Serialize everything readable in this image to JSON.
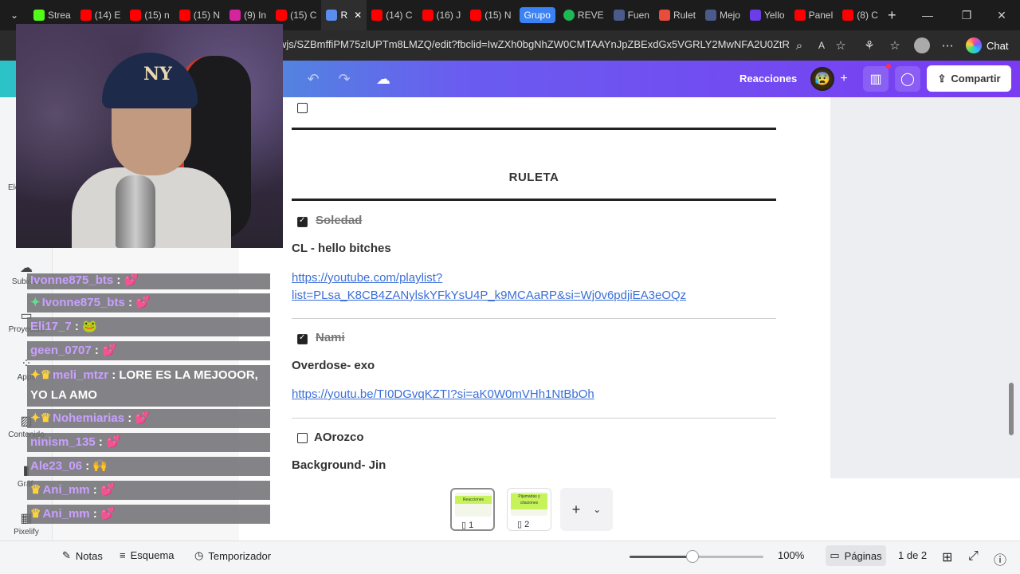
{
  "browser": {
    "tabs": [
      {
        "label": "Strea",
        "color": "#53fc18"
      },
      {
        "label": "(14) E",
        "color": "#ff0000"
      },
      {
        "label": "(15) n",
        "color": "#ff0000"
      },
      {
        "label": "(15) N",
        "color": "#ff0000"
      },
      {
        "label": "(9) In",
        "color": "#d6249f"
      },
      {
        "label": "(15) C",
        "color": "#ff0000"
      },
      {
        "label": "R",
        "color": "#5b8def"
      },
      {
        "label": "(14) C",
        "color": "#ff0000"
      },
      {
        "label": "(16) J",
        "color": "#ff0000"
      },
      {
        "label": "(15) N",
        "color": "#ff0000"
      }
    ],
    "group_label": "Grupo",
    "tabs_right": [
      {
        "label": "REVE",
        "color": "#1db954"
      },
      {
        "label": "Fuen",
        "color": "#4a5a8a"
      },
      {
        "label": "Rulet",
        "color": "#e84c3d"
      },
      {
        "label": "Mejo",
        "color": "#4a5a8a"
      },
      {
        "label": "Yello",
        "color": "#6a3de8"
      },
      {
        "label": "Panel",
        "color": "#ff0000"
      },
      {
        "label": "(8) C",
        "color": "#ff0000"
      }
    ],
    "url": "wjs/SZBmffiPM75zlUPTm8LMZQ/edit?fbclid=IwZXh0bgNhZW0CMTAAYnJpZBExdGx5VGRLY2MwNFA2U0ZtR...",
    "chat_label": "Chat"
  },
  "canva": {
    "reacciones": "Reacciones",
    "share_label": "Compartir",
    "sidebar": [
      "Subidos",
      "Proyectos",
      "Apps",
      "Contenido",
      "Gráf.",
      "Pixelify"
    ],
    "sidebar_partial": "Ele"
  },
  "doc": {
    "title": "RULETA",
    "entries": [
      {
        "name": "Soledad",
        "done": true,
        "song": "CL - hello bitches",
        "link_line1": "https://youtube.com/playlist?",
        "link_line2": "list=PLsa_K8CB4ZANylskYFkYsU4P_k9MCAaRP&si=Wj0v6pdjiEA3eOQz"
      },
      {
        "name": "Nami",
        "done": true,
        "song": "Overdose- exo",
        "link_line1": "https://youtu.be/TI0DGvqKZTI?si=aK0W0mVHh1NtBbOh",
        "link_line2": ""
      },
      {
        "name": "AOrozco",
        "done": false,
        "song": "Background- Jin",
        "link_line1": "",
        "link_line2": ""
      }
    ]
  },
  "pages": {
    "thumbs": [
      {
        "num": "1",
        "caption": "Reacciones"
      },
      {
        "num": "2",
        "caption": "Pijamadas y citaciones"
      }
    ]
  },
  "bottom": {
    "notas": "Notas",
    "esquema": "Esquema",
    "temporizador": "Temporizador",
    "zoom": "100%",
    "zoom_value": 0.47,
    "paginas": "Páginas",
    "page_count": "1 de 2"
  },
  "stream_chat": [
    {
      "user": "Ivonne875_bts",
      "sep": " : ",
      "msg": "",
      "emote": "💕",
      "badges": ""
    },
    {
      "user": "Ivonne875_bts",
      "sep": " : ",
      "msg": "",
      "emote": "💕",
      "badges": "✦"
    },
    {
      "user": "Eli17_7",
      "sep": " : ",
      "msg": "",
      "emote": "🐸",
      "badges": ""
    },
    {
      "user": "geen_0707",
      "sep": " : ",
      "msg": "",
      "emote": "💕",
      "badges": ""
    },
    {
      "user": "meli_mtzr",
      "sep": " : ",
      "msg": "LORE ES LA MEJOOOR, YO LA AMO",
      "emote": "",
      "badges": "✦♛"
    },
    {
      "user": "Nohemiarias",
      "sep": " : ",
      "msg": "",
      "emote": "💕",
      "badges": "✦♛"
    },
    {
      "user": "ninism_135",
      "sep": " : ",
      "msg": "",
      "emote": "💕",
      "badges": ""
    },
    {
      "user": "Ale23_06",
      "sep": " : ",
      "msg": "",
      "emote": "🙌",
      "badges": ""
    },
    {
      "user": "Ani_mm",
      "sep": " : ",
      "msg": "",
      "emote": "💕",
      "badges": "♛"
    },
    {
      "user": "Ani_mm",
      "sep": " : ",
      "msg": "",
      "emote": "💕",
      "badges": "♛"
    }
  ]
}
